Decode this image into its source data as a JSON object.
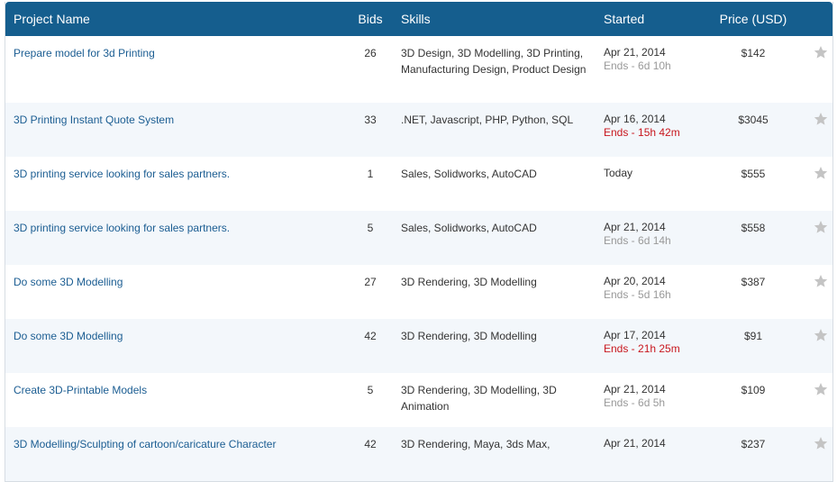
{
  "header": {
    "project_name": "Project Name",
    "bids": "Bids",
    "skills": "Skills",
    "started": "Started",
    "price": "Price (USD)"
  },
  "rows": [
    {
      "name": "Prepare model for 3d Printing",
      "bids": "26",
      "skills": "3D Design, 3D Modelling, 3D Printing, Manufacturing Design, Product Design",
      "date": "Apr 21, 2014",
      "ends": "Ends - 6d 10h",
      "urgent": false,
      "price": "$142"
    },
    {
      "name": "3D Printing Instant Quote System",
      "bids": "33",
      "skills": ".NET, Javascript, PHP, Python, SQL",
      "date": "Apr 16, 2014",
      "ends": "Ends - 15h 42m",
      "urgent": true,
      "price": "$3045"
    },
    {
      "name": "3D printing service looking for sales partners.",
      "bids": "1",
      "skills": "Sales, Solidworks, AutoCAD",
      "date": "Today",
      "ends": "",
      "urgent": false,
      "price": "$555"
    },
    {
      "name": "3D printing service looking for sales partners.",
      "bids": "5",
      "skills": "Sales, Solidworks, AutoCAD",
      "date": "Apr 21, 2014",
      "ends": "Ends - 6d 14h",
      "urgent": false,
      "price": "$558"
    },
    {
      "name": "Do some 3D Modelling",
      "bids": "27",
      "skills": "3D Rendering, 3D Modelling",
      "date": "Apr 20, 2014",
      "ends": "Ends - 5d 16h",
      "urgent": false,
      "price": "$387"
    },
    {
      "name": "Do some 3D Modelling",
      "bids": "42",
      "skills": "3D Rendering, 3D Modelling",
      "date": "Apr 17, 2014",
      "ends": "Ends - 21h 25m",
      "urgent": true,
      "price": "$91"
    },
    {
      "name": "Create 3D-Printable Models",
      "bids": "5",
      "skills": "3D Rendering, 3D Modelling, 3D Animation",
      "date": "Apr 21, 2014",
      "ends": "Ends - 6d 5h",
      "urgent": false,
      "price": "$109"
    },
    {
      "name": "3D Modelling/Sculpting of cartoon/caricature Character",
      "bids": "42",
      "skills": "3D Rendering, Maya, 3ds Max,",
      "date": "Apr 21, 2014",
      "ends": "",
      "urgent": false,
      "price": "$237"
    }
  ],
  "colors": {
    "header_bg": "#155e8e",
    "link": "#1b5d92",
    "urgent": "#c8171e",
    "muted": "#999999",
    "star": "#c4c4c4",
    "row_alt": "#f3f7fb"
  },
  "icons": {
    "watch": "star-icon"
  }
}
